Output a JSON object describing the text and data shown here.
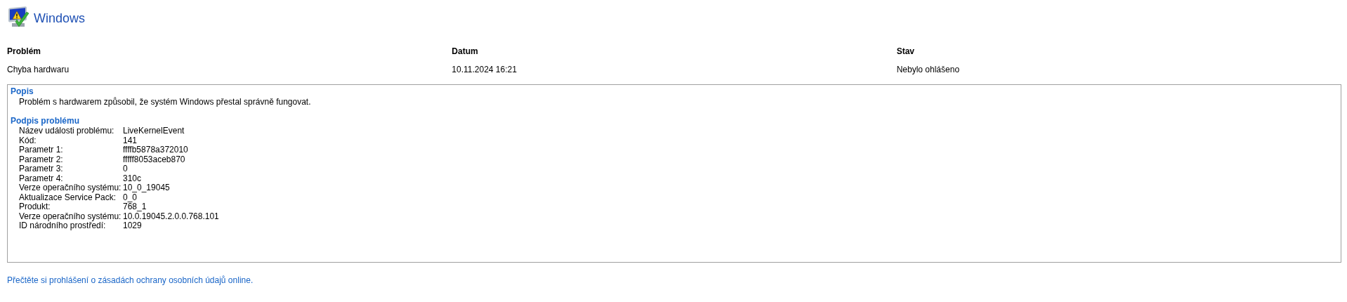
{
  "title": "Windows",
  "summary": {
    "columns": [
      {
        "heading": "Problém",
        "value": "Chyba hardwaru"
      },
      {
        "heading": "Datum",
        "value": "10.11.2024 16:21"
      },
      {
        "heading": "Stav",
        "value": "Nebylo ohlášeno"
      }
    ]
  },
  "details": {
    "description_heading": "Popis",
    "description": "Problém s hardwarem způsobil, že systém Windows přestal správně fungovat.",
    "signature_heading": "Podpis problému",
    "signature": [
      {
        "label": "Název události problému:",
        "value": "LiveKernelEvent"
      },
      {
        "label": "Kód:",
        "value": "141"
      },
      {
        "label": "Parametr 1:",
        "value": "ffffb5878a372010"
      },
      {
        "label": "Parametr 2:",
        "value": "fffff8053aceb870"
      },
      {
        "label": "Parametr 3:",
        "value": "0"
      },
      {
        "label": "Parametr 4:",
        "value": "310c"
      },
      {
        "label": "Verze operačního systému:",
        "value": "10_0_19045"
      },
      {
        "label": "Aktualizace Service Pack:",
        "value": "0_0"
      },
      {
        "label": "Produkt:",
        "value": "768_1"
      },
      {
        "label": "Verze operačního systému:",
        "value": "10.0.19045.2.0.0.768.101"
      },
      {
        "label": "ID národního prostředí:",
        "value": "1029"
      }
    ]
  },
  "privacy_link": "Přečtěte si prohlášení o zásadách ochrany osobních údajů online."
}
